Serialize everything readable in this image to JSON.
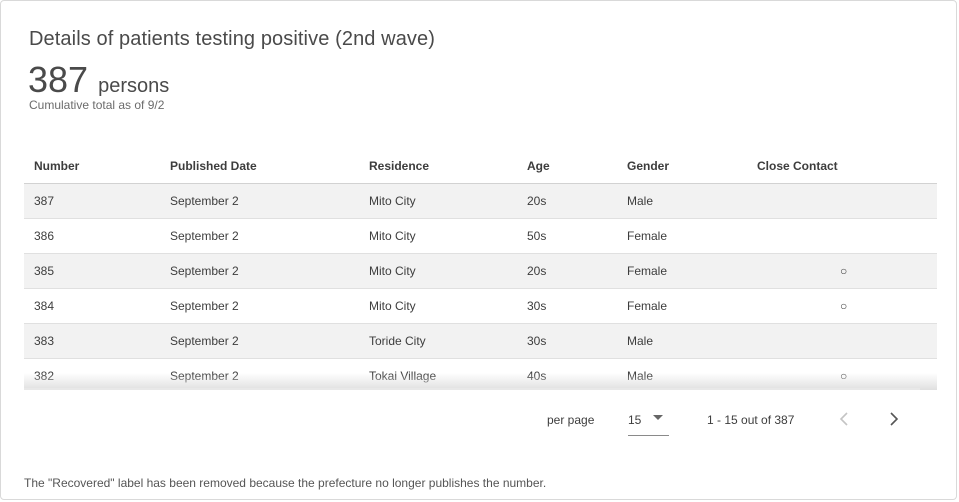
{
  "card": {
    "title": "Details of patients testing positive (2nd wave)",
    "total_value": "387",
    "total_unit": "persons",
    "caption": "Cumulative total as of 9/2"
  },
  "table": {
    "headers": [
      "Number",
      "Published Date",
      "Residence",
      "Age",
      "Gender",
      "Close Contact"
    ],
    "rows": [
      [
        "387",
        "September 2",
        "Mito City",
        "20s",
        "Male",
        ""
      ],
      [
        "386",
        "September 2",
        "Mito City",
        "50s",
        "Female",
        ""
      ],
      [
        "385",
        "September 2",
        "Mito City",
        "20s",
        "Female",
        "○"
      ],
      [
        "384",
        "September 2",
        "Mito City",
        "30s",
        "Female",
        "○"
      ],
      [
        "383",
        "September 2",
        "Toride City",
        "30s",
        "Male",
        ""
      ],
      [
        "382",
        "September 2",
        "Tokai Village",
        "40s",
        "Male",
        "○"
      ]
    ]
  },
  "pager": {
    "per_page_label": "per page",
    "per_page_value": "15",
    "range_text": "1 - 15 out of 387",
    "prev_icon": "chevron-left-icon",
    "next_icon": "chevron-right-icon"
  },
  "note": "The \"Recovered\" label has been removed because the prefecture no longer publishes the number."
}
